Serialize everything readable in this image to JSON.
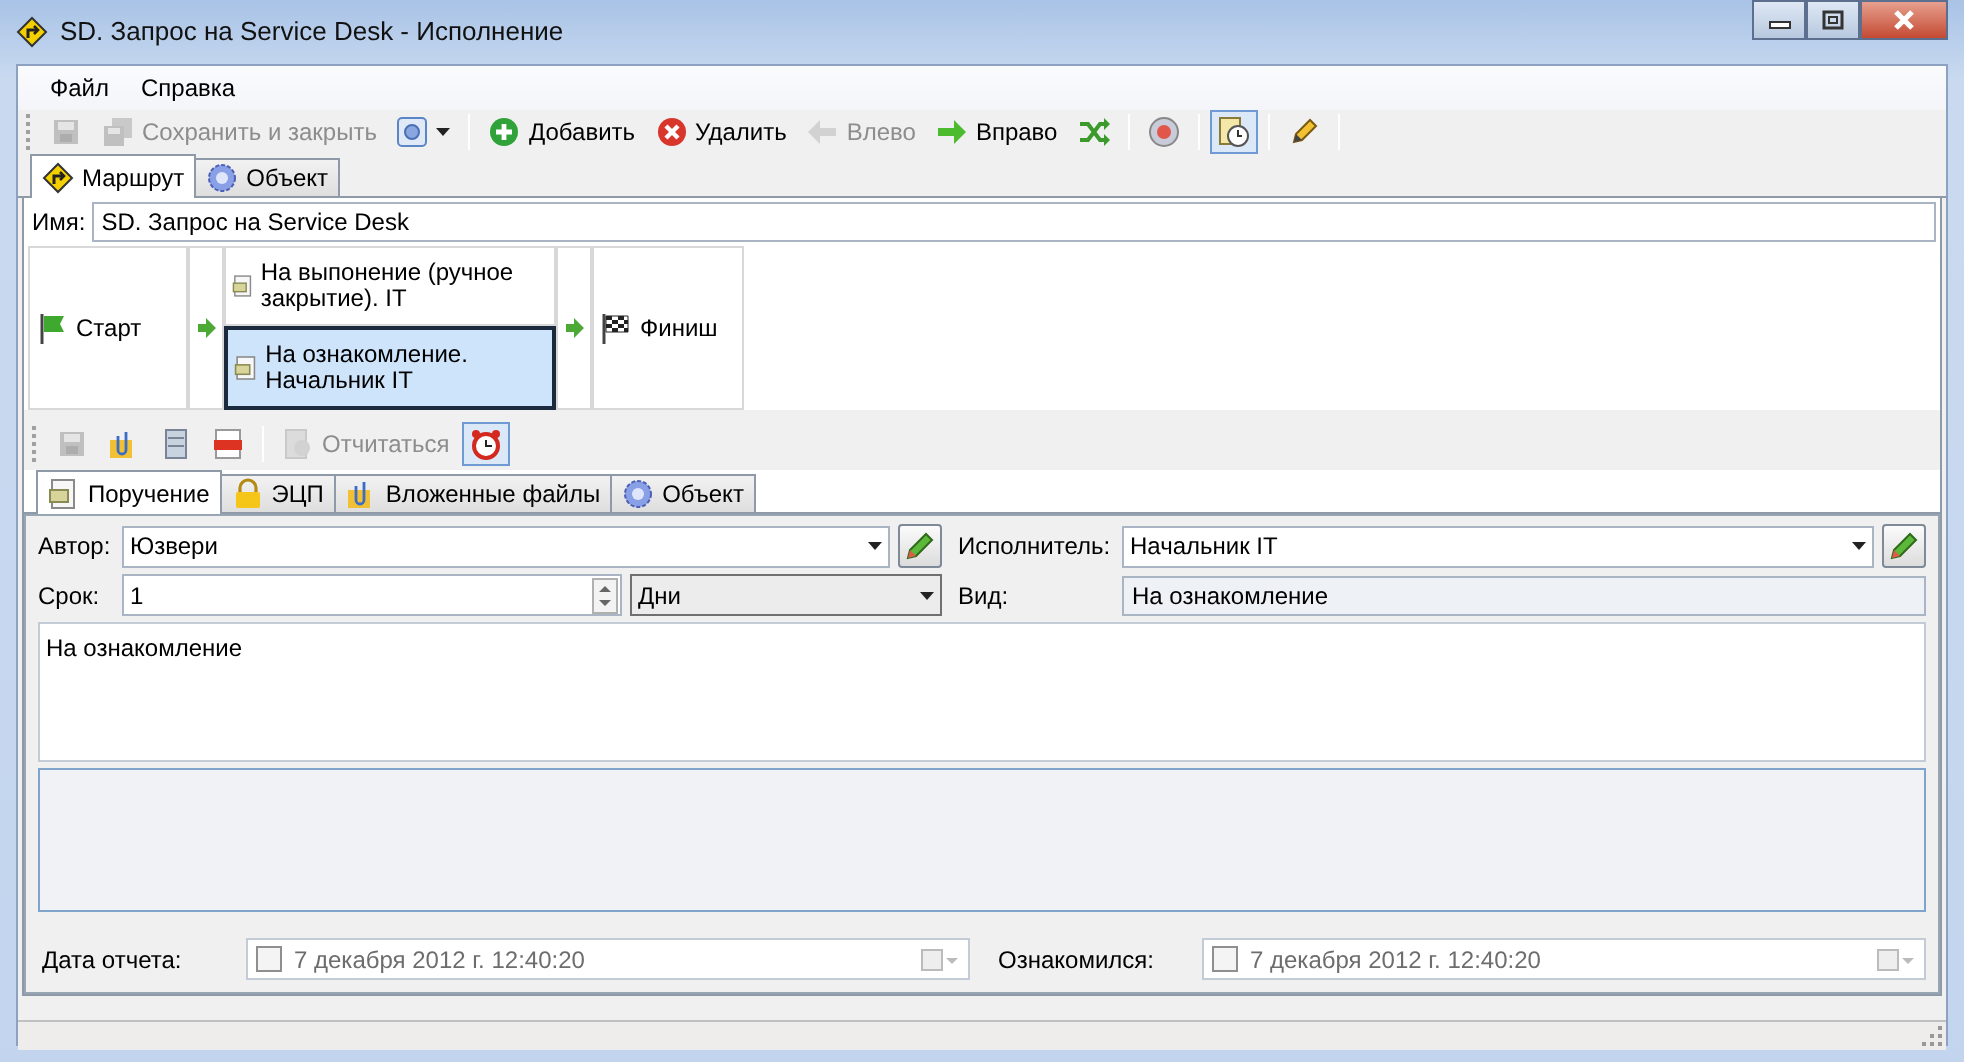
{
  "window": {
    "title": "SD. Запрос на Service Desk - Исполнение"
  },
  "menu": [
    "Файл",
    "Справка"
  ],
  "toolbar": [
    {
      "kind": "icon",
      "disabled": true,
      "pressed": false
    },
    {
      "kind": "text",
      "label": "Сохранить и закрыть",
      "disabled": true,
      "pressed": false
    },
    {
      "kind": "dropdown",
      "disabled": false,
      "pressed": false
    },
    {
      "kind": "separator"
    },
    {
      "kind": "text",
      "label": "Добавить",
      "disabled": false,
      "pressed": false
    },
    {
      "kind": "text",
      "label": "Удалить",
      "disabled": false,
      "pressed": false
    },
    {
      "kind": "text",
      "label": "Влево",
      "disabled": true,
      "pressed": false
    },
    {
      "kind": "text",
      "label": "Вправо",
      "disabled": false,
      "pressed": false
    },
    {
      "kind": "icon",
      "disabled": false,
      "pressed": false
    },
    {
      "kind": "separator"
    },
    {
      "kind": "icon",
      "disabled": false,
      "pressed": false
    },
    {
      "kind": "separator"
    },
    {
      "kind": "icon",
      "disabled": false,
      "pressed": true
    },
    {
      "kind": "separator"
    },
    {
      "kind": "icon",
      "disabled": false,
      "pressed": false
    },
    {
      "kind": "separator"
    }
  ],
  "route_tabs": [
    {
      "label": "Маршрут",
      "selected": true
    },
    {
      "label": "Объект",
      "selected": false
    }
  ],
  "name_field": {
    "label": "Имя:",
    "value": "SD. Запрос на Service Desk"
  },
  "route": {
    "start": "Старт",
    "steps": [
      {
        "label": "На выпонение (ручное закрытие). IT",
        "selected": false
      },
      {
        "label": "На ознакомление. Начальник IT",
        "selected": true
      }
    ],
    "finish": "Финиш"
  },
  "task_toolbar": [
    {
      "kind": "icon",
      "disabled": true,
      "pressed": false
    },
    {
      "kind": "icon",
      "disabled": false,
      "pressed": false
    },
    {
      "kind": "icon",
      "disabled": false,
      "pressed": false
    },
    {
      "kind": "icon",
      "disabled": false,
      "pressed": false
    },
    {
      "kind": "separator"
    },
    {
      "kind": "text",
      "label": "Отчитаться",
      "disabled": true,
      "pressed": false
    },
    {
      "kind": "icon",
      "disabled": false,
      "pressed": true
    }
  ],
  "task_tabs": [
    {
      "label": "Поручение",
      "selected": true
    },
    {
      "label": "ЭЦП",
      "selected": false
    },
    {
      "label": "Вложенные файлы",
      "selected": false
    },
    {
      "label": "Объект",
      "selected": false
    }
  ],
  "form": {
    "author": {
      "label": "Автор:",
      "value": "Юзвери"
    },
    "performer": {
      "label": "Исполнитель:",
      "value": "Начальник IT"
    },
    "term": {
      "label": "Срок:",
      "value": "1",
      "unit": "Дни"
    },
    "type": {
      "label": "Вид:",
      "value": "На ознакомление"
    },
    "instruction": "На ознакомление",
    "report_date": {
      "label": "Дата отчета:",
      "value": "7 декабря  2012 г. 12:40:20",
      "checked": false
    },
    "acknowledged": {
      "label": "Ознакомился:",
      "value": "7 декабря  2012 г. 12:40:20",
      "checked": false
    }
  }
}
